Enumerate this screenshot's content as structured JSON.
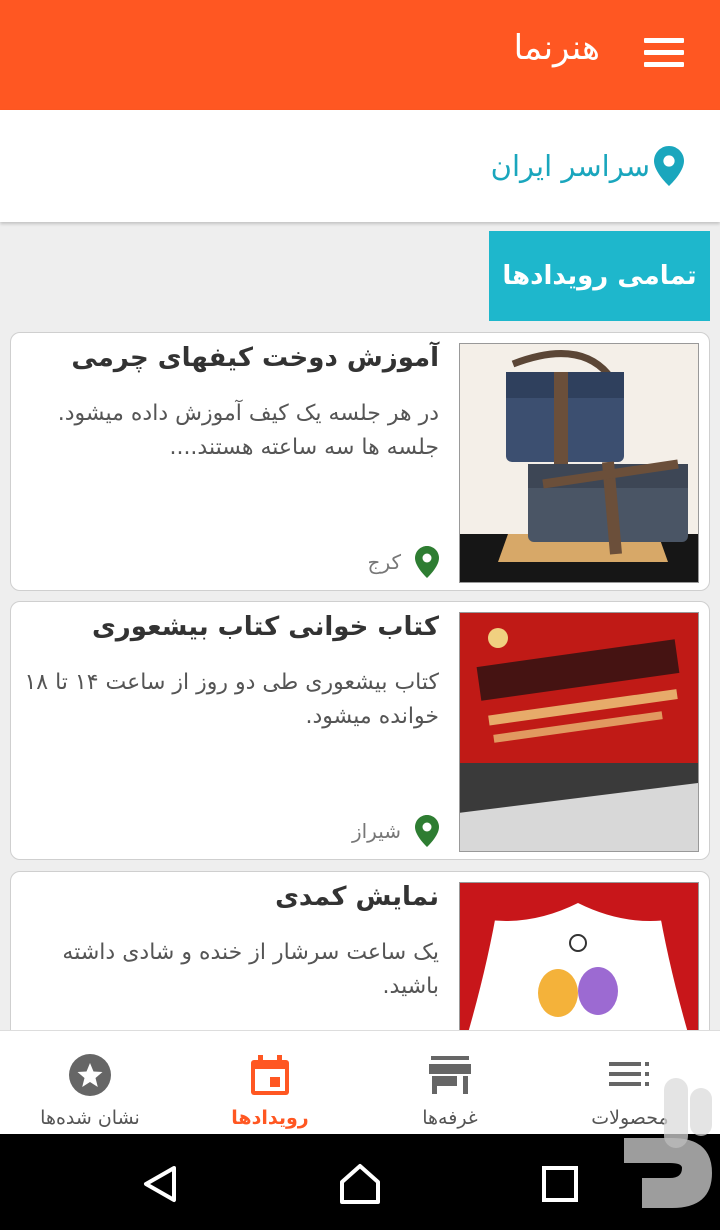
{
  "app": {
    "title": "هنرنما"
  },
  "location": {
    "label": "سراسر ایران"
  },
  "section": {
    "button_label": "تمامی رویدادها"
  },
  "events": [
    {
      "title": "آموزش دوخت کیفهای چرمی",
      "description": "در هر جلسه یک کیف آموزش داده میشود. جلسه ها سه ساعته هستند....",
      "city": "کرج",
      "image": "leather-bags-photo"
    },
    {
      "title": "کتاب خوانی کتاب بیشعوری",
      "description": "کتاب بیشعوری طی دو روز از ساعت ۱۴ تا ۱۸ خوانده میشود.",
      "city": "شیراز",
      "image": "book-cover-photo"
    },
    {
      "title": "نمایش کمدی",
      "description": "یک ساعت سرشار از خنده و شادی داشته باشید.",
      "city": "",
      "image": "theater-curtain-masks"
    }
  ],
  "bottom_nav": {
    "products": "محصولات",
    "booths": "غرفه‌ها",
    "events": "رویدادها",
    "bookmarks": "نشان شده‌ها",
    "active": "events"
  },
  "colors": {
    "primary": "#ff5722",
    "accent": "#1eb7cc",
    "location_pin": "#1aa6bd",
    "card_pin": "#2e7d32"
  },
  "icons": {
    "menu": "hamburger-icon",
    "location": "map-pin-icon",
    "products": "list-icon",
    "booths": "store-icon",
    "events": "calendar-icon",
    "bookmarks": "star-circle-icon"
  }
}
